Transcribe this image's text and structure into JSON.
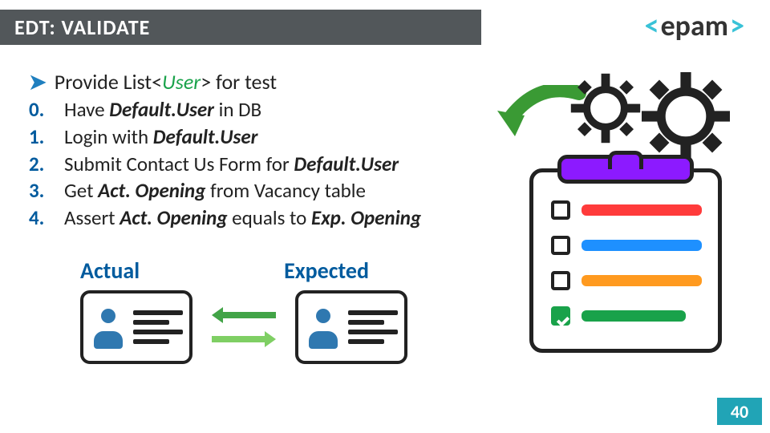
{
  "header": {
    "title": "EDT: VALIDATE"
  },
  "logo": {
    "open": "<",
    "brand": "epam",
    "close": ">"
  },
  "bullet": {
    "pre": "Provide List<",
    "generic": "User",
    "post": "> for test"
  },
  "steps": [
    {
      "num": "0.",
      "parts": [
        "Have ",
        "Default.User",
        " in DB"
      ]
    },
    {
      "num": "1.",
      "parts": [
        "Login with ",
        "Default.User",
        ""
      ]
    },
    {
      "num": "2.",
      "parts": [
        "Submit Contact Us Form for ",
        "Default.User",
        ""
      ]
    },
    {
      "num": "3.",
      "parts": [
        "Get ",
        "Act. Opening",
        " from Vacancy table"
      ]
    },
    {
      "num": "4.",
      "parts": [
        "Assert ",
        "Act. Opening",
        " equals to ",
        "Exp. Opening"
      ]
    }
  ],
  "compare": {
    "actual": "Actual",
    "expected": "Expected"
  },
  "colors": {
    "accent_blue": "#005b9e",
    "accent_teal": "#21a4b6",
    "header_grey": "#52575a",
    "green": "#19a24a"
  },
  "page_number": "40"
}
